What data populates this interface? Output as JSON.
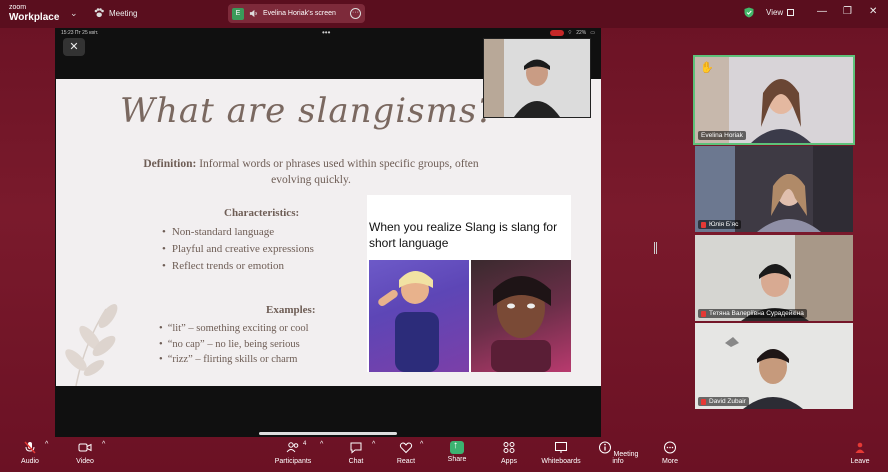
{
  "titlebar": {
    "logo_line1": "zoom",
    "logo_line2": "Workplace",
    "meeting_label": "Meeting",
    "share_badge": "E",
    "share_text": "Evelina Horiak's screen",
    "view_label": "View",
    "minimize": "—",
    "restore": "❐",
    "close": "✕"
  },
  "ipad": {
    "time": "15:23  Пт 25 квіт.",
    "dots": "•••",
    "battery": "22%"
  },
  "slide": {
    "title": "What are slangisms?",
    "definition_label": "Definition:",
    "definition_text": " Informal words or phrases used within specific groups, often evolving quickly.",
    "characteristics_heading": "Characteristics:",
    "characteristics": [
      "Non-standard language",
      "Playful and creative expressions",
      "Reflect trends or emotion"
    ],
    "examples_heading": "Examples:",
    "examples": [
      "“lit” – something exciting or cool",
      "“no cap” – no lie, being serious",
      "“rizz” – flirting skills or charm"
    ],
    "meme_caption": "When you realize Slang is slang for short language"
  },
  "participants": [
    {
      "name": "Evelina Horiak",
      "muted": false,
      "hand_raised": true,
      "active": true
    },
    {
      "name": "Юлія Бʼяс",
      "muted": true
    },
    {
      "name": "Тетяна Валеріївна Сурадейкіна",
      "muted": true
    },
    {
      "name": "David Zubair",
      "muted": true
    }
  ],
  "toolbar": {
    "audio": "Audio",
    "video": "Video",
    "participants": "Participants",
    "participants_count": "4",
    "chat": "Chat",
    "react": "React",
    "share": "Share",
    "apps": "Apps",
    "whiteboards": "Whiteboards",
    "meeting_info": "Meeting info",
    "more": "More",
    "leave": "Leave"
  },
  "colors": {
    "background": "#6e1326",
    "active_speaker": "#5ec27a",
    "share_green": "#3cb371",
    "muted_red": "#e53935"
  }
}
